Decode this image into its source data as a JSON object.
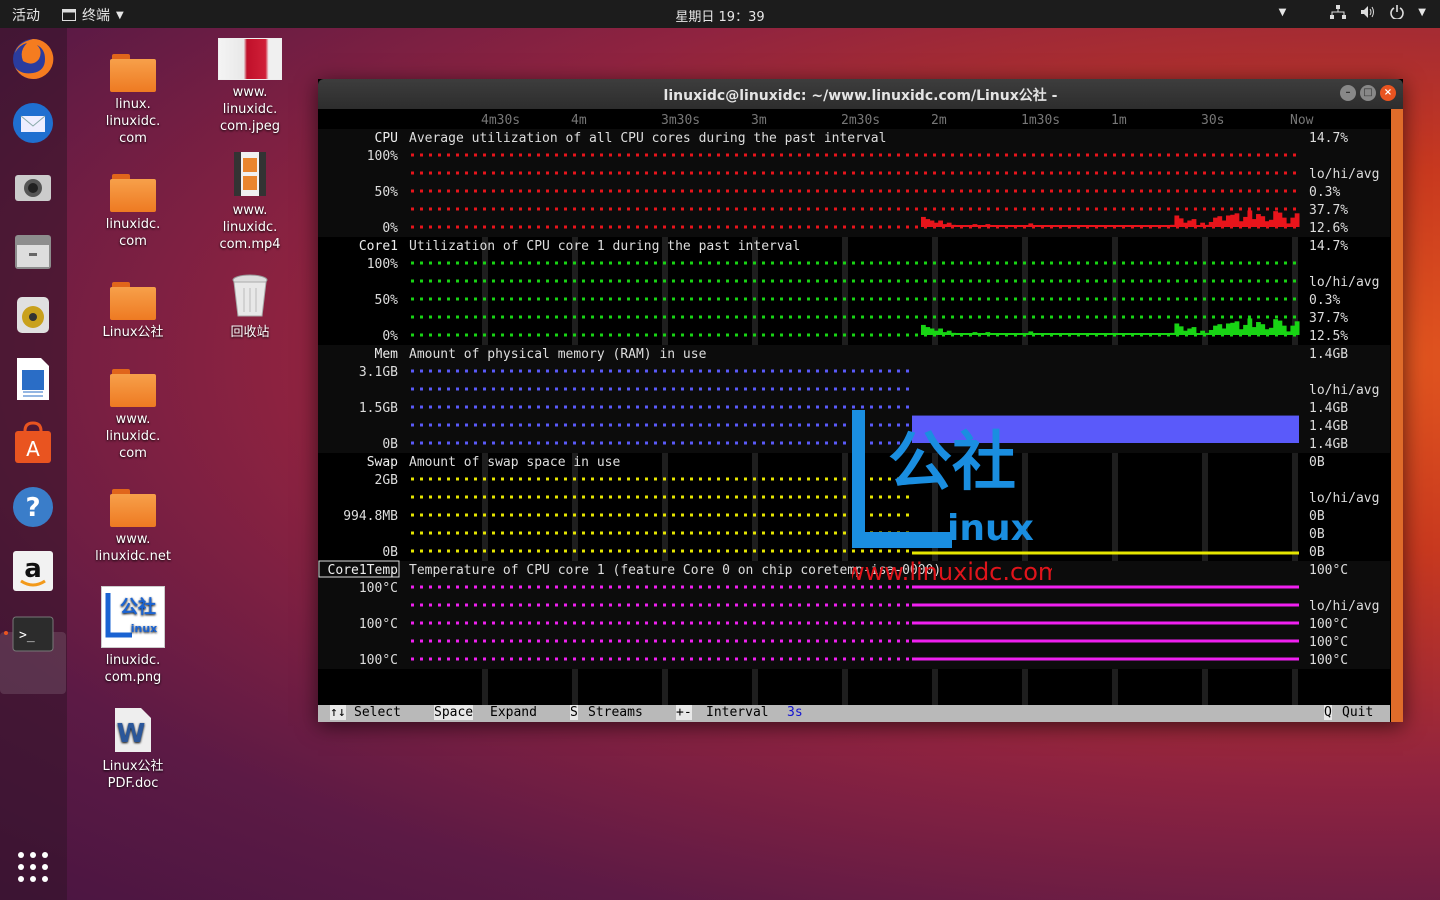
{
  "topbar": {
    "activities": "活动",
    "app_name": "终端",
    "clock": "星期日 19：39"
  },
  "dock": {
    "items": [
      "firefox-icon",
      "thunderbird-icon",
      "camera-icon",
      "files-icon",
      "rhythmbox-icon",
      "writer-icon",
      "software-icon",
      "help-icon",
      "amazon-icon",
      "terminal-icon",
      "app-grid-icon"
    ],
    "help_glyph": "?",
    "amazon_glyph": "a",
    "software_glyph": "A",
    "terminal_glyph": ">_"
  },
  "desktop": {
    "icons": [
      {
        "label": "linux.\nlinuxidc.\ncom",
        "type": "folder"
      },
      {
        "label": "linuxidc.\ncom",
        "type": "folder"
      },
      {
        "label": "Linux公社",
        "type": "folder"
      },
      {
        "label": "www.\nlinuxidc.\ncom",
        "type": "folder"
      },
      {
        "label": "www.\nlinuxidc.net",
        "type": "folder"
      },
      {
        "label": "linuxidc.\ncom.png",
        "type": "image"
      },
      {
        "label": "Linux公社\nPDF.doc",
        "type": "doc"
      },
      {
        "label": "www.\nlinuxidc.\ncom.jpeg",
        "type": "photo"
      },
      {
        "label": "www.\nlinuxidc.\ncom.mp4",
        "type": "video"
      },
      {
        "label": "回收站",
        "type": "trash"
      }
    ],
    "doc_glyph": "W",
    "png_logo": "公社",
    "png_logo_sub": "inux"
  },
  "terminal": {
    "title": "linuxidc@linuxidc: ~/www.linuxidc.com/Linux公社 -",
    "time_axis": [
      "4m30s",
      "4m",
      "3m30s",
      "3m",
      "2m30s",
      "2m",
      "1m30s",
      "1m",
      "30s",
      "Now"
    ],
    "panels": [
      {
        "name": "CPU",
        "desc": "Average utilization of all CPU cores during the past interval",
        "y_top": "100%",
        "y_mid": "50%",
        "y_bot": "0%",
        "color": "#e8141b",
        "current": "14.7%",
        "stats_label": "lo/hi/avg",
        "lo": "0.3%",
        "hi": "37.7%",
        "avg": "12.6%",
        "history_pct": [
          14,
          11,
          9,
          6,
          9,
          4,
          6,
          3,
          0,
          0,
          0,
          0,
          4,
          0,
          0,
          4,
          2,
          0,
          0,
          0,
          0,
          0,
          0,
          0,
          0,
          5,
          2,
          0,
          2,
          0,
          0,
          0,
          0,
          0,
          0,
          0,
          0,
          0,
          0,
          0,
          0,
          0,
          0,
          0,
          0,
          0,
          0,
          0,
          0,
          0,
          0,
          0,
          0,
          0,
          0,
          0,
          0,
          0,
          3,
          16,
          12,
          6,
          9,
          11,
          2,
          6,
          3,
          7,
          13,
          15,
          9,
          16,
          17,
          19,
          8,
          14,
          23,
          11,
          18,
          15,
          8,
          10,
          22,
          20,
          13,
          5,
          13,
          19
        ]
      },
      {
        "name": "Core1",
        "desc": "Utilization of CPU core 1 during the past interval",
        "y_top": "100%",
        "y_mid": "50%",
        "y_bot": "0%",
        "color": "#18d414",
        "current": "14.7%",
        "stats_label": "lo/hi/avg",
        "lo": "0.3%",
        "hi": "37.7%",
        "avg": "12.5%",
        "history_pct": [
          14,
          11,
          9,
          6,
          9,
          4,
          6,
          3,
          0,
          0,
          0,
          0,
          4,
          0,
          0,
          4,
          2,
          0,
          0,
          0,
          0,
          0,
          0,
          0,
          0,
          5,
          2,
          0,
          2,
          0,
          0,
          0,
          0,
          0,
          0,
          0,
          0,
          0,
          0,
          0,
          0,
          0,
          0,
          0,
          0,
          0,
          0,
          0,
          0,
          0,
          0,
          0,
          0,
          0,
          0,
          0,
          0,
          0,
          3,
          16,
          12,
          6,
          9,
          11,
          2,
          6,
          3,
          7,
          13,
          15,
          9,
          16,
          17,
          19,
          8,
          14,
          23,
          11,
          18,
          15,
          8,
          10,
          22,
          20,
          13,
          5,
          13,
          19
        ]
      },
      {
        "name": "Mem",
        "desc": "Amount of physical memory (RAM) in use",
        "y_top": "3.1GB",
        "y_mid": "1.5GB",
        "y_bot": "0B",
        "color": "#5a5afa",
        "current": "1.4GB",
        "stats_label": "lo/hi/avg",
        "lo": "1.4GB",
        "hi": "1.4GB",
        "avg": "1.4GB",
        "level_pct": 45
      },
      {
        "name": "Swap",
        "desc": "Amount of swap space in use",
        "y_top": "2GB",
        "y_mid": "994.8MB",
        "y_bot": "0B",
        "color": "#e6e600",
        "current": "0B",
        "stats_label": "lo/hi/avg",
        "lo": "0B",
        "hi": "0B",
        "avg": "0B",
        "level_pct": 0
      },
      {
        "name": "Core1Temp",
        "desc": "Temperature of CPU core 1 (feature Core 0 on chip coretemp-isa-0000)",
        "y_top": "100°C",
        "y_mid": "100°C",
        "y_bot": "100°C",
        "color": "#f020f0",
        "current": "100°C",
        "stats_label": "lo/hi/avg",
        "lo": "100°C",
        "hi": "100°C",
        "avg": "100°C",
        "level_pct": 100
      }
    ],
    "status": {
      "select_key": "↑↓",
      "select_label": "Select",
      "expand_key": "Space",
      "expand_label": "Expand",
      "streams_key": "S",
      "streams_label": "Streams",
      "interval_key": "+-",
      "interval_label": "Interval",
      "interval_value": "3s",
      "quit_key": "Q",
      "quit_label": "Quit"
    }
  },
  "watermark": {
    "big": "公社",
    "sub": "inux",
    "url": "www.linuxidc.com"
  }
}
